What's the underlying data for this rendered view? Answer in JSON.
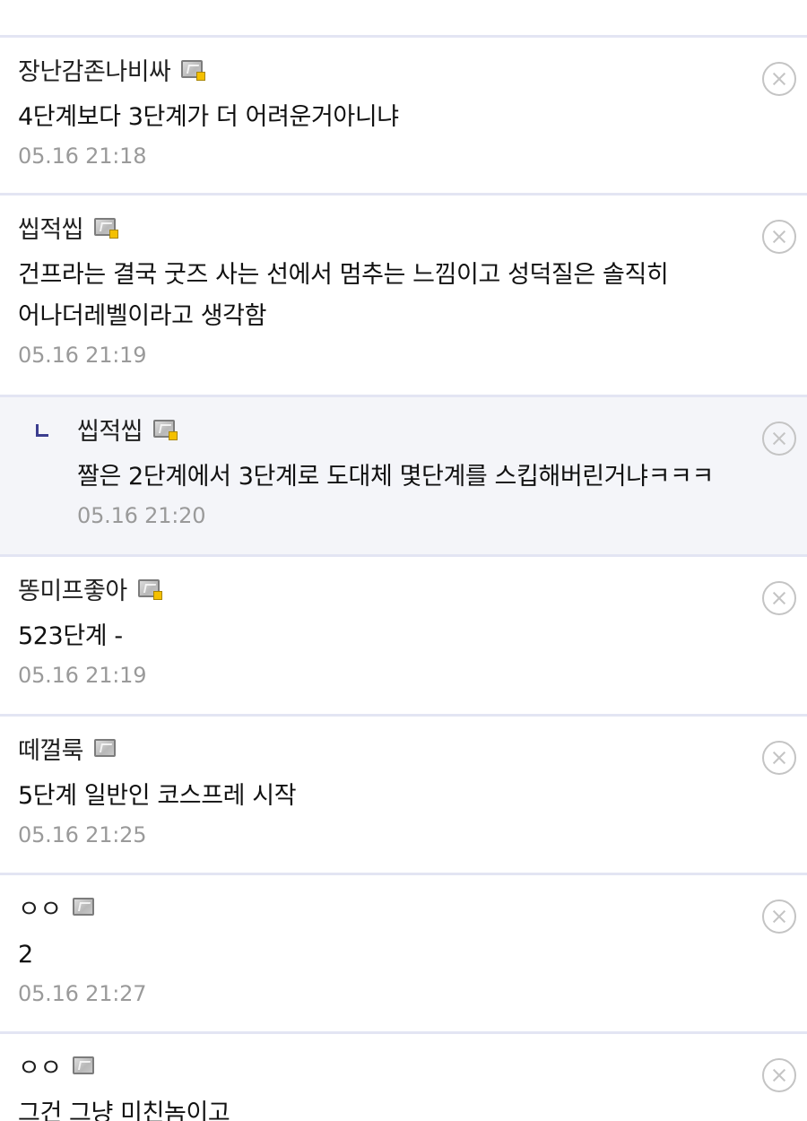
{
  "comments": [
    {
      "nick": "장난감존나비싸",
      "badge": "level-badge-icon",
      "body": "4단계보다 3단계가 더 어려운거아니냐",
      "time": "05.16 21:18"
    },
    {
      "nick": "씹적씹",
      "badge": "level-badge-icon",
      "body": "건프라는 결국 굿즈 사는 선에서 멈추는 느낌이고 성덕질은 솔직히 어나더레벨이라고 생각함",
      "time": "05.16 21:19"
    },
    {
      "nick": "씹적씹",
      "badge": "level-badge-icon",
      "reply": true,
      "body": "짤은 2단계에서 3단계로 도대체 몇단계를 스킵해버린거냐ㅋㅋㅋ",
      "time": "05.16 21:20"
    },
    {
      "nick": "똥미프좋아",
      "badge": "level-badge-icon",
      "body": "523단계 -",
      "time": "05.16 21:19"
    },
    {
      "nick": "떼껄룩",
      "badge": "level-badge-icon",
      "body": "5단계 일반인 코스프레 시작",
      "time": "05.16 21:25"
    },
    {
      "nick": "ㅇㅇ",
      "badge": "level-badge-icon",
      "body": "2",
      "time": "05.16 21:27"
    },
    {
      "nick": "ㅇㅇ",
      "badge": "level-badge-icon",
      "body": "그건 그냥 미친놈이고",
      "time": ""
    }
  ],
  "icons": {
    "delete": "close-circle-icon",
    "reply": "reply-arrow-icon"
  },
  "colors": {
    "divider": "#e3e5f3",
    "reply_background": "#f4f5f9",
    "reply_marker": "#3b3d8f",
    "timestamp": "#9a9a9a",
    "badge_dot": "#f4c000"
  }
}
